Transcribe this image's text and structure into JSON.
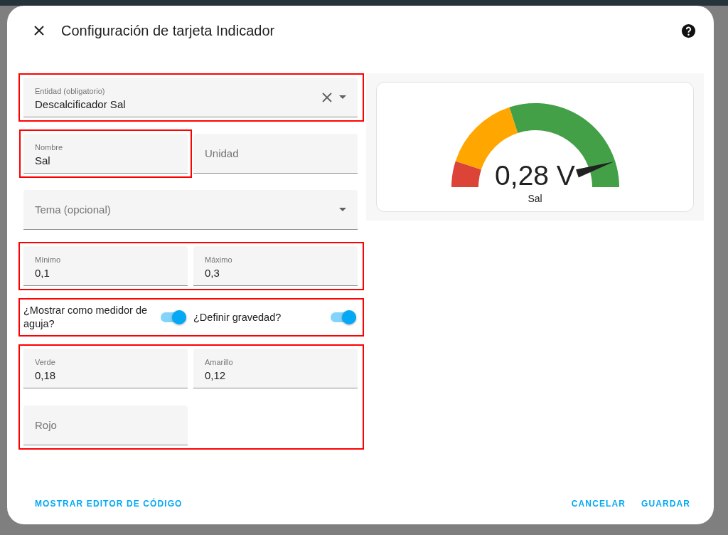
{
  "dialog": {
    "title": "Configuración de tarjeta Indicador"
  },
  "form": {
    "rows": [
      {
        "highlighted": true,
        "items": [
          {
            "kind": "select",
            "label": "Entidad (obligatorio)",
            "value": "Descalcificador Sal",
            "clearable": true,
            "highlighted": false
          }
        ]
      },
      {
        "highlighted": false,
        "items": [
          {
            "kind": "text",
            "label": "Nombre",
            "value": "Sal",
            "highlighted": true
          },
          {
            "kind": "text",
            "label": "Unidad",
            "highlighted": false
          }
        ]
      },
      {
        "highlighted": false,
        "items": [
          {
            "kind": "select",
            "label": "Tema (opcional)",
            "clearable": false,
            "highlighted": false
          }
        ]
      },
      {
        "highlighted": true,
        "items": [
          {
            "kind": "text",
            "label": "Mínimo",
            "value": "0,1",
            "highlighted": false
          },
          {
            "kind": "text",
            "label": "Máximo",
            "value": "0,3",
            "highlighted": false
          }
        ]
      },
      {
        "highlighted": true,
        "items": [
          {
            "kind": "switch",
            "label": "¿Mostrar como medidor de aguja?",
            "on": true,
            "highlighted": false
          },
          {
            "kind": "switch",
            "label": "¿Definir gravedad?",
            "on": true,
            "highlighted": false
          }
        ]
      },
      {
        "highlighted": true,
        "items": [
          {
            "kind": "text",
            "label": "Verde",
            "value": "0,18",
            "highlighted": false
          },
          {
            "kind": "text",
            "label": "Amarillo",
            "value": "0,12",
            "highlighted": false
          },
          {
            "kind": "text",
            "label": "Rojo",
            "highlighted": false
          }
        ]
      }
    ]
  },
  "preview": {
    "value": "0,28 V",
    "name": "Sal",
    "level": 0.9
  },
  "footer": {
    "left": [
      "MOSTRAR EDITOR DE CÓDIGO"
    ],
    "right": [
      "CANCELAR",
      "GUARDAR"
    ]
  }
}
